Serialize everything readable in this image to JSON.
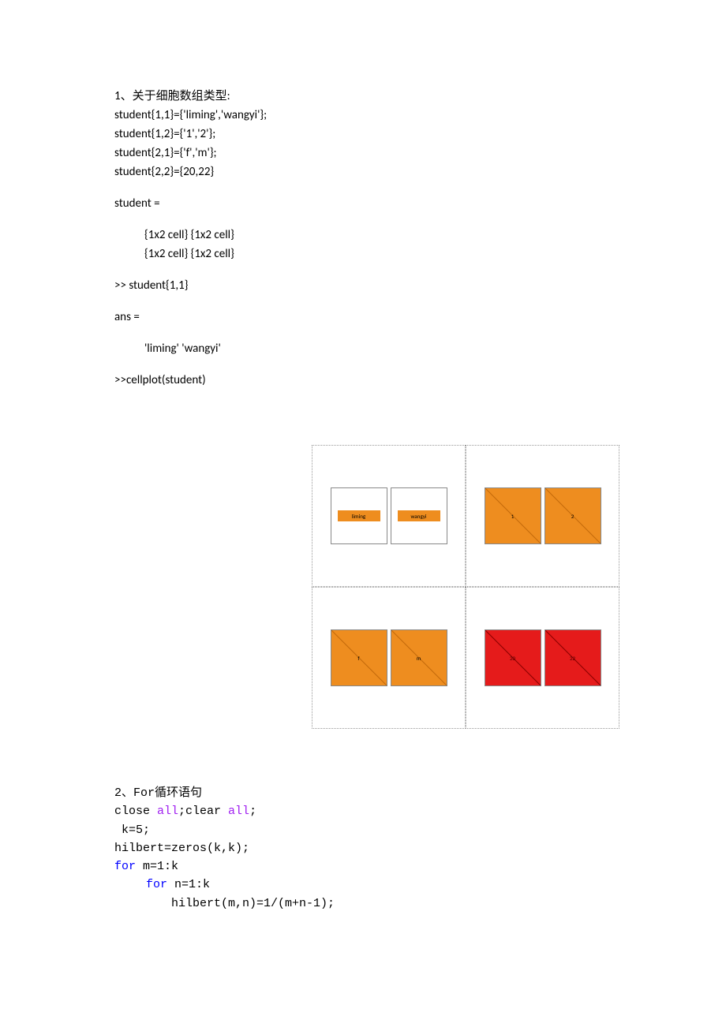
{
  "section1": {
    "title": "1、关于细胞数组类型:",
    "code": [
      "student{1,1}={'liming','wangyi'};",
      "student{1,2}={'1','2'};",
      "student{2,1}={'f','m'};",
      "student{2,2}={20,22}"
    ],
    "out_label": "student =",
    "row1": "{1x2 cell}        {1x2 cell}",
    "row2": "{1x2 cell}        {1x2 cell}",
    "prompt1": ">> student{1,1}",
    "ans_label": "ans =",
    "ans_val": "'liming'        'wangyi'",
    "prompt2": ">>cellplot(student)"
  },
  "cellplot": {
    "q1": {
      "a": "liming",
      "b": "wangyi"
    },
    "q2": {
      "a": "1",
      "b": "2"
    },
    "q3": {
      "a": "f",
      "b": "m"
    },
    "q4": {
      "a": "20",
      "b": "22"
    }
  },
  "section2": {
    "title": "2、For循环语句",
    "l1a": "close ",
    "l1b": "all",
    "l1c": ";clear ",
    "l1d": "all",
    "l1e": ";",
    "l2": " k=5;",
    "l3": "hilbert=zeros(k,k);",
    "l4a": "for",
    "l4b": " m=1:k",
    "l5a": "for",
    "l5b": " n=1:k",
    "l6": "hilbert(m,n)=1/(m+n-1);"
  }
}
